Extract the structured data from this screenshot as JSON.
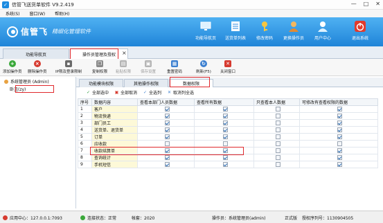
{
  "app": {
    "title": "信管飞送货单软件 V9.2.419"
  },
  "window_controls": {
    "minimize": "—",
    "maximize": "□",
    "close": "✕"
  },
  "menu": [
    "系统(S)",
    "窗口(W)",
    "帮助(H)"
  ],
  "banner": {
    "logo": "信管飞",
    "slogan": "精细化管理软件",
    "nav": [
      {
        "label": "功能导航页",
        "icon": "monitor-icon"
      },
      {
        "label": "送货单列表",
        "icon": "list-icon"
      },
      {
        "label": "修改密码",
        "icon": "key-icon"
      },
      {
        "label": "更换操作员",
        "icon": "user-switch-icon"
      },
      {
        "label": "用户中心",
        "icon": "user-center-icon"
      },
      {
        "label": "退出系统",
        "icon": "power-icon"
      }
    ]
  },
  "tabs": [
    {
      "label": "功能导航页",
      "active": false
    },
    {
      "label": "操作员管理及授权",
      "active": true
    }
  ],
  "tab_close": "×",
  "toolbar": [
    {
      "label": "添加操作员",
      "icon": "add-user-icon",
      "color": "#3aa83a",
      "enabled": true
    },
    {
      "label": "删除操作员",
      "icon": "delete-user-icon",
      "color": "#d63a2f",
      "enabled": true
    },
    {
      "label": "IP限及登录限制",
      "icon": "ip-limit-icon",
      "color": "#6a6a6a",
      "enabled": true
    },
    {
      "label": "复制权限",
      "icon": "copy-icon",
      "color": "#8a8a8a",
      "enabled": true
    },
    {
      "label": "粘贴权限",
      "icon": "paste-icon",
      "color": "#b5b5b5",
      "enabled": false
    },
    {
      "label": "保存设置",
      "icon": "save-icon",
      "color": "#b5b5b5",
      "enabled": false
    },
    {
      "label": "重置密码",
      "icon": "reset-password-icon",
      "color": "#3b7fd0",
      "enabled": true
    },
    {
      "label": "刷新(F5)",
      "icon": "refresh-icon",
      "color": "#3b7fd0",
      "enabled": true
    },
    {
      "label": "关闭窗口",
      "icon": "close-window-icon",
      "color": "#d63a2f",
      "enabled": true
    }
  ],
  "tree": [
    {
      "label": "系统管理员 (Admin)"
    },
    {
      "label": "卧丑(zy)"
    }
  ],
  "subtabs": [
    {
      "label": "功能模块权限",
      "active": false
    },
    {
      "label": "其他操作权限",
      "active": false
    },
    {
      "label": "数据权限",
      "active": true
    }
  ],
  "actions": [
    {
      "label": "全部选中",
      "icon": "check-all-icon"
    },
    {
      "label": "全部取消",
      "icon": "uncheck-all-icon"
    },
    {
      "label": "全选列",
      "icon": "check-column-icon"
    },
    {
      "label": "取消列全选",
      "icon": "uncheck-column-icon"
    }
  ],
  "table": {
    "headers": [
      "序号",
      "数据内容",
      "查看本部门人员数据",
      "查看所有数据",
      "只查看本人数据",
      "可修改有查看权限的数据"
    ],
    "rows": [
      {
        "no": "1",
        "name": "客户",
        "dept": true,
        "all": true,
        "self": false,
        "edit": true
      },
      {
        "no": "2",
        "name": "物流快递",
        "dept": true,
        "all": true,
        "self": false,
        "edit": true
      },
      {
        "no": "3",
        "name": "部门员工",
        "dept": true,
        "all": true,
        "self": false,
        "edit": true
      },
      {
        "no": "4",
        "name": "送货单、退货单",
        "dept": true,
        "all": true,
        "self": false,
        "edit": true
      },
      {
        "no": "5",
        "name": "订单",
        "dept": true,
        "all": true,
        "self": false,
        "edit": true
      },
      {
        "no": "6",
        "name": "应收款",
        "dept": false,
        "all": false,
        "self": false,
        "edit": false
      },
      {
        "no": "7",
        "name": "收款结算单",
        "dept": true,
        "all": true,
        "self": false,
        "edit": true
      },
      {
        "no": "8",
        "name": "查询统计",
        "dept": true,
        "all": true,
        "self": false,
        "edit": true
      },
      {
        "no": "9",
        "name": "手机短信",
        "dept": true,
        "all": true,
        "self": false,
        "edit": true
      }
    ]
  },
  "status": {
    "app_center": "应用中心：127.0.0.1:7093",
    "connection": "连接状态：正常",
    "account_set": "帐套：2020",
    "operator": "操作员：系统管理员(admin)",
    "edition": "正式版",
    "serial": "授权序列号：1130904505"
  }
}
